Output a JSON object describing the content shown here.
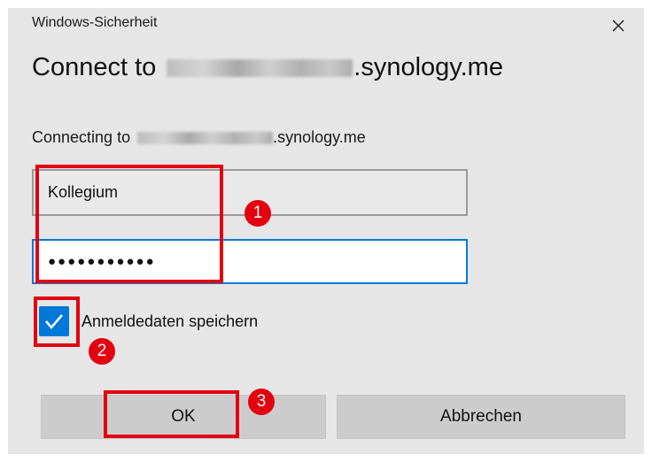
{
  "window": {
    "title": "Windows-Sicherheit",
    "close_icon": "close-icon"
  },
  "dialog": {
    "heading_prefix": "Connect to",
    "heading_suffix": ".synology.me",
    "subheading_prefix": "Connecting to",
    "subheading_suffix": ".synology.me"
  },
  "form": {
    "username_value": "Kollegium",
    "password_masked": "●●●●●●●●●●●",
    "remember_label": "Anmeldedaten speichern",
    "remember_checked": true
  },
  "buttons": {
    "ok_label": "OK",
    "cancel_label": "Abbrechen"
  },
  "annotations": {
    "step1": "1",
    "step2": "2",
    "step3": "3",
    "color": "#e3000f"
  },
  "colors": {
    "accent": "#0078d7",
    "dialog_bg": "#e6e6e6",
    "button_bg": "#cccccc"
  }
}
